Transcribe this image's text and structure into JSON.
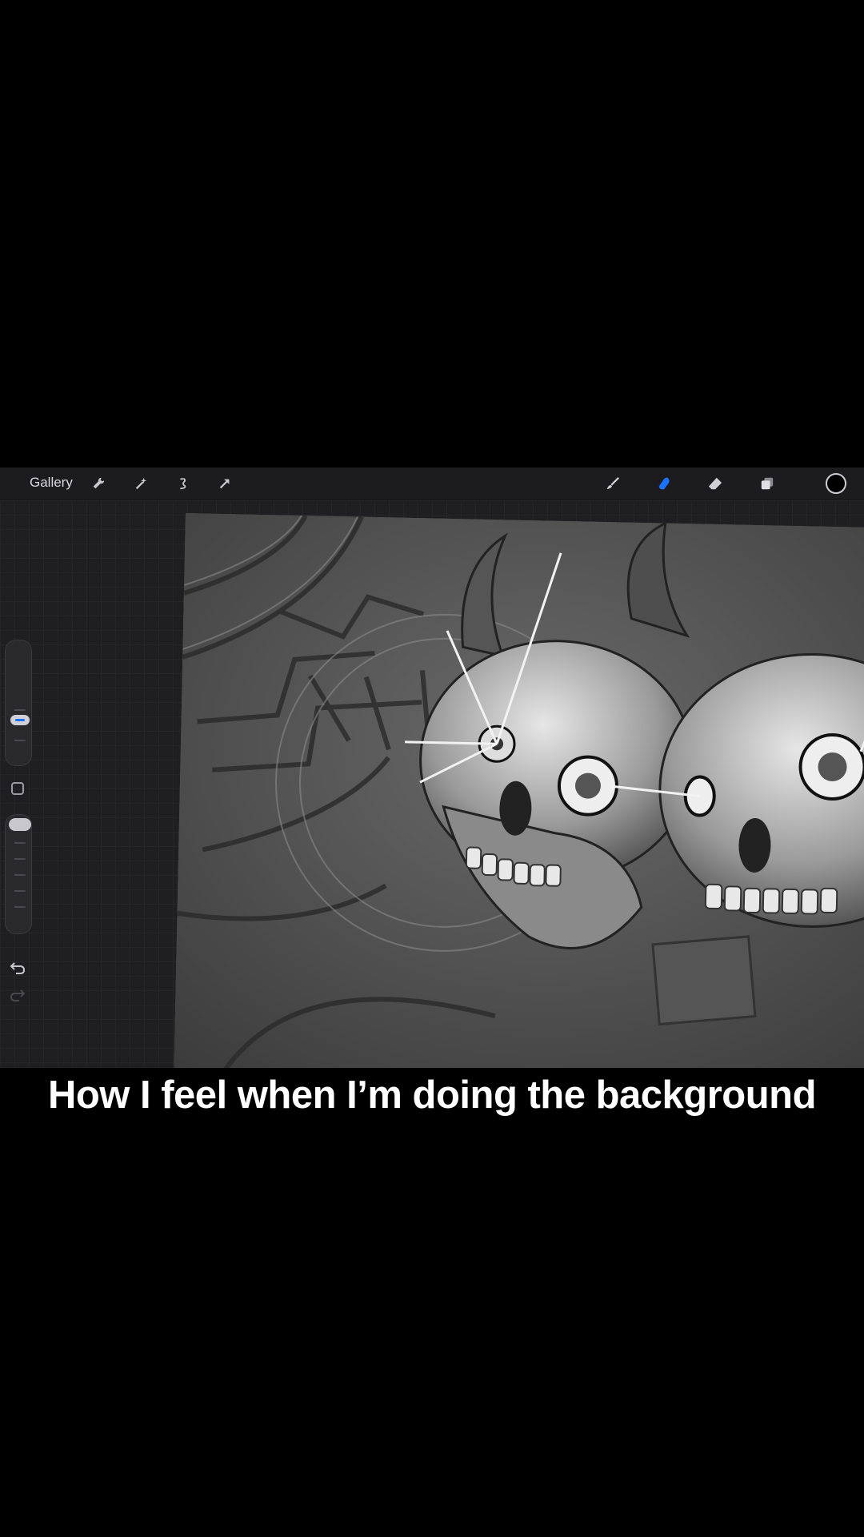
{
  "app": {
    "gallery_label": "Gallery",
    "toolbar_left_icons": [
      "wrench-icon",
      "magic-wand-icon",
      "selection-icon",
      "transform-arrow-icon"
    ],
    "toolbar_right_icons": [
      "brush-icon",
      "smudge-icon",
      "eraser-icon",
      "layers-icon"
    ],
    "active_tool": "smudge",
    "accent_color": "#1a73ff",
    "current_color": "#000000"
  },
  "sidebar": {
    "brush_size_level": 0.35,
    "opacity_level": 1.0,
    "icons": [
      "modify-square-icon",
      "undo-icon",
      "redo-icon"
    ]
  },
  "caption": {
    "text": "How I feel when I’m doing the background"
  }
}
